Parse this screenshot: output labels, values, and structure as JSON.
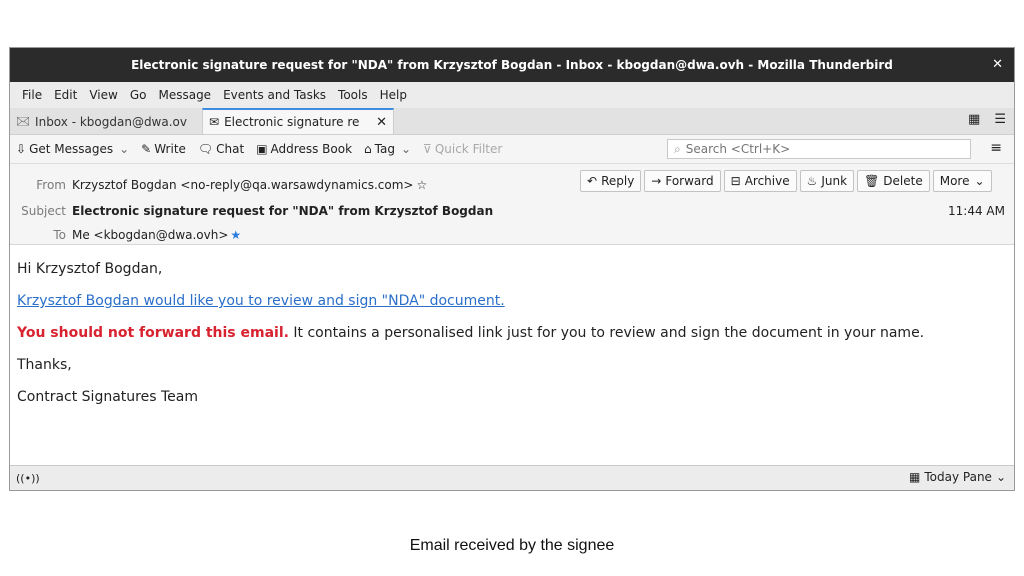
{
  "window": {
    "title": "Electronic signature request for \"NDA\" from Krzysztof Bogdan - Inbox - kbogdan@dwa.ovh - Mozilla Thunderbird"
  },
  "menu": [
    "File",
    "Edit",
    "View",
    "Go",
    "Message",
    "Events and Tasks",
    "Tools",
    "Help"
  ],
  "tabs": {
    "inbox": "Inbox - kbogdan@dwa.ov",
    "message": "Electronic signature re"
  },
  "toolbar": {
    "get_messages": "Get Messages",
    "write": "Write",
    "chat": "Chat",
    "address_book": "Address Book",
    "tag": "Tag",
    "quick_filter": "Quick Filter",
    "search_placeholder": "Search <Ctrl+K>"
  },
  "header": {
    "from_label": "From",
    "from_value": "Krzysztof Bogdan <no-reply@qa.warsawdynamics.com>",
    "subject_label": "Subject",
    "subject_value": "Electronic signature request for \"NDA\" from Krzysztof Bogdan",
    "to_label": "To",
    "to_value": "Me <kbogdan@dwa.ovh>",
    "time": "11:44 AM",
    "actions": {
      "reply": "Reply",
      "forward": "Forward",
      "archive": "Archive",
      "junk": "Junk",
      "delete": "Delete",
      "more": "More"
    }
  },
  "body": {
    "greeting": "Hi Krzysztof Bogdan,",
    "link": "Krzysztof Bogdan would like you to review and sign \"NDA\" document.",
    "warning_bold": "You should not forward this email.",
    "warning_rest": " It contains a personalised link just for you to review and sign the document in your name.",
    "thanks": "Thanks,",
    "signature": "Contract Signatures Team"
  },
  "statusbar": {
    "today_pane": "Today Pane"
  },
  "caption": "Email received by the signee",
  "colors": {
    "titlebar": "#2b2b2b",
    "link": "#2a6fc9",
    "warning": "#d8222f",
    "accent": "#3d8ee0"
  }
}
